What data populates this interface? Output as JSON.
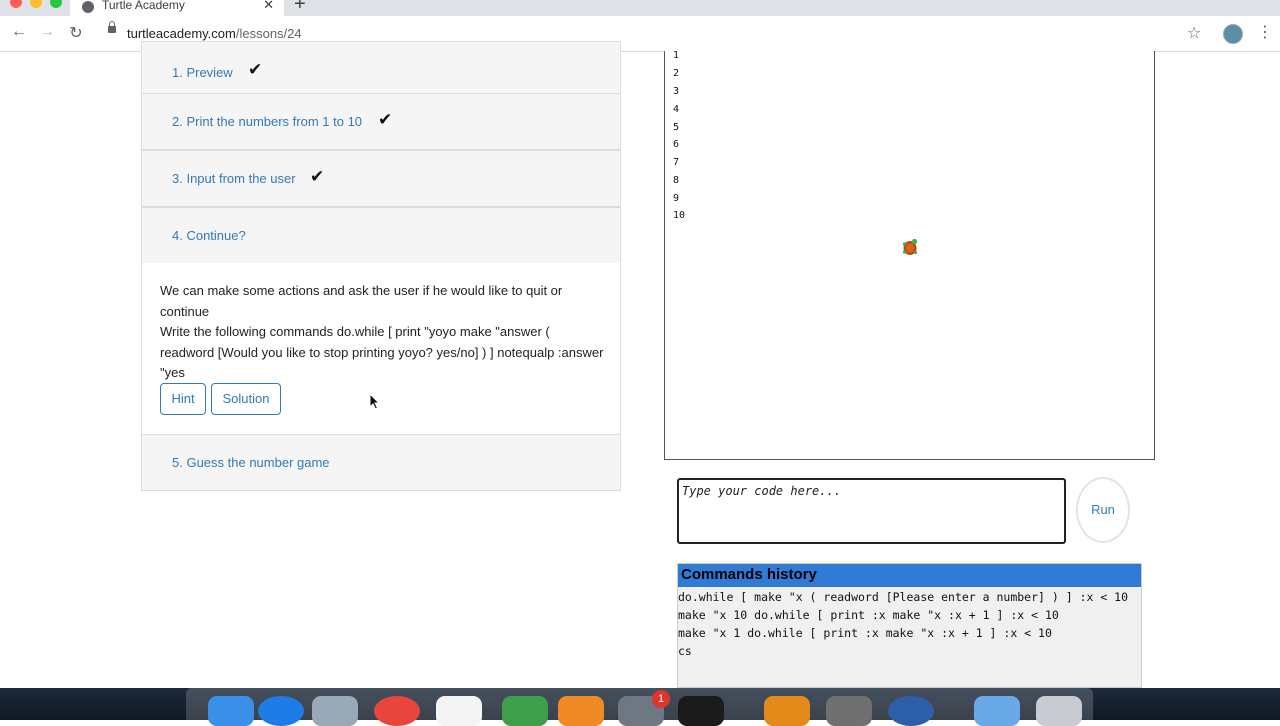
{
  "browser": {
    "tab_title": "Turtle Academy",
    "url_host": "turtleacademy.com",
    "url_path": "/lessons/24"
  },
  "lesson": {
    "steps": [
      {
        "label": "1. Preview",
        "completed": true
      },
      {
        "label": "2. Print the numbers from 1 to 10",
        "completed": true
      },
      {
        "label": "3. Input from the user",
        "completed": true
      },
      {
        "label": "4. Continue?",
        "completed": false
      },
      {
        "label": "5. Guess the number game",
        "completed": false
      }
    ],
    "active_step_text_1": "We can make some actions and ask the user if he would like to quit or continue",
    "active_step_text_2": "Write the following commands do.while [ print \"yoyo make \"answer ( readword [Would you like to stop printing yoyo? yes/no] ) ] notequalp :answer \"yes",
    "hint_label": "Hint",
    "solution_label": "Solution"
  },
  "canvas": {
    "output_lines": [
      "1",
      "2",
      "3",
      "4",
      "5",
      "6",
      "7",
      "8",
      "9",
      "10"
    ]
  },
  "editor": {
    "placeholder": "Type your code here...",
    "run_label": "Run"
  },
  "history": {
    "title": "Commands history",
    "lines": [
      "do.while [ make \"x ( readword [Please enter a number] ) ] :x < 10",
      "make \"x 10 do.while [ print :x make \"x :x + 1 ] :x < 10",
      "make \"x 1 do.while [ print :x make \"x :x + 1 ] :x < 10",
      "cs"
    ]
  },
  "dock": {
    "notification_badge": "1"
  },
  "colors": {
    "link": "#337ab7",
    "history_header": "#2f7bd6",
    "panel_bg": "#f5f5f5"
  }
}
